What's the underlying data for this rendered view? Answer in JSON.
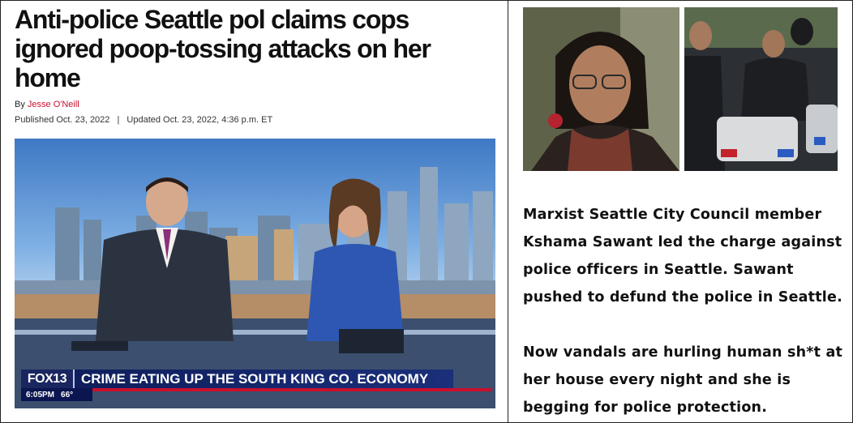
{
  "article": {
    "headline": "Anti-police Seattle pol claims cops ignored poop-tossing attacks on her home",
    "byline_prefix": "By",
    "author": "Jesse O'Neill",
    "published": "Published Oct. 23, 2022",
    "separator": "|",
    "updated": "Updated Oct. 23, 2022, 4:36 p.m. ET"
  },
  "video": {
    "station_logo": "FOX13",
    "ticker_headline": "CRIME EATING UP THE SOUTH KING CO. ECONOMY",
    "time": "6:05PM",
    "temperature": "66°"
  },
  "caption": {
    "paragraph_1": "Marxist Seattle City Council member Kshama Sawant led the charge against police officers in Seattle. Sawant pushed to defund the police in Seattle.",
    "paragraph_2": "Now vandals are hurling human sh*t at her house every night and she is begging for police protection."
  },
  "colors": {
    "author_link": "#c8102e",
    "ticker_bg": "#1b2f7a",
    "ticker_accent": "#c8102e"
  }
}
